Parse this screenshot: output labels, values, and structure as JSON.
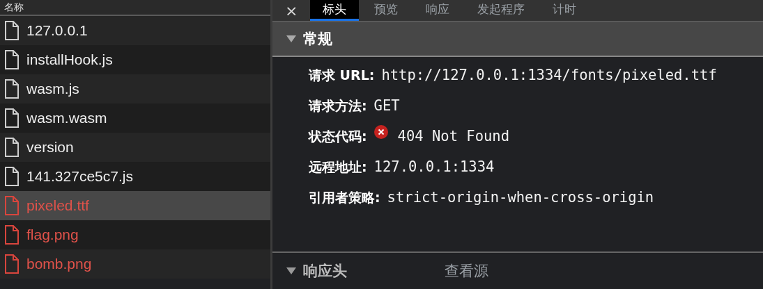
{
  "file_list": {
    "column_title": "名称",
    "files": [
      {
        "name": "127.0.0.1",
        "failed": false,
        "selected": false
      },
      {
        "name": "installHook.js",
        "failed": false,
        "selected": false
      },
      {
        "name": "wasm.js",
        "failed": false,
        "selected": false
      },
      {
        "name": "wasm.wasm",
        "failed": false,
        "selected": false
      },
      {
        "name": "version",
        "failed": false,
        "selected": false
      },
      {
        "name": "141.327ce5c7.js",
        "failed": false,
        "selected": false
      },
      {
        "name": "pixeled.ttf",
        "failed": true,
        "selected": true
      },
      {
        "name": "flag.png",
        "failed": true,
        "selected": false
      },
      {
        "name": "bomb.png",
        "failed": true,
        "selected": false
      }
    ]
  },
  "detail": {
    "close": "×",
    "tabs": [
      {
        "label": "标头",
        "selected": true
      },
      {
        "label": "预览",
        "selected": false
      },
      {
        "label": "响应",
        "selected": false
      },
      {
        "label": "发起程序",
        "selected": false
      },
      {
        "label": "计时",
        "selected": false
      }
    ],
    "general": {
      "title": "常规",
      "expanded": true,
      "fields": [
        {
          "label": "请求 URL:",
          "value": "http://127.0.0.1:1334/fonts/pixeled.ttf",
          "kind": "text"
        },
        {
          "label": "请求方法:",
          "value": "GET",
          "kind": "text"
        },
        {
          "label": "状态代码:",
          "value": "404 Not Found",
          "kind": "error"
        },
        {
          "label": "远程地址:",
          "value": "127.0.0.1:1334",
          "kind": "text"
        },
        {
          "label": "引用者策略:",
          "value": "strict-origin-when-cross-origin",
          "kind": "text"
        }
      ]
    },
    "response_headers": {
      "title": "响应头",
      "expanded": true,
      "action": "查看源"
    }
  }
}
